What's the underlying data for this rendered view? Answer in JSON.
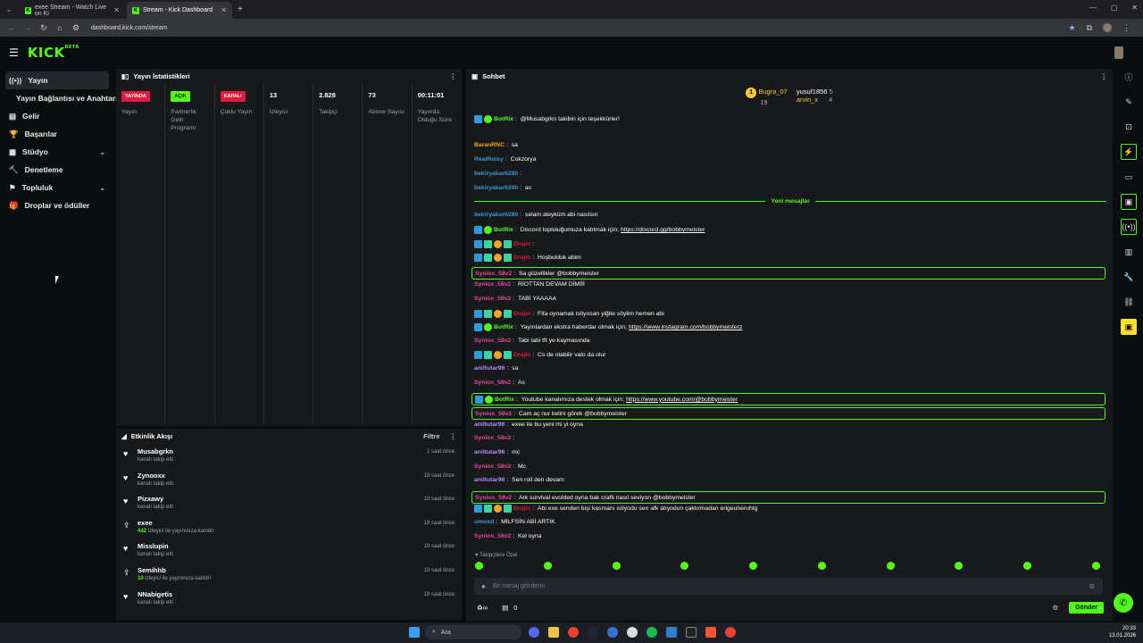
{
  "browser": {
    "tabs": [
      {
        "title": "exee Stream - Watch Live on Ki",
        "active": false
      },
      {
        "title": "Stream - Kick Dashboard",
        "active": true
      }
    ],
    "url": "dashboard.kick.com/stream"
  },
  "brand": {
    "logo": "KICK",
    "logo_sup": "BETA",
    "accent": "#53fc18"
  },
  "sidebar": {
    "items": [
      {
        "label": "Yayın",
        "icon": "broadcast-icon"
      },
      {
        "label": "Yayın Bağlantısı ve Anahtarı"
      },
      {
        "label": "Gelir",
        "icon": "wallet-icon"
      },
      {
        "label": "Başarılar",
        "icon": "trophy-icon"
      },
      {
        "label": "Stüdyo",
        "icon": "studio-icon"
      },
      {
        "label": "Denetleme",
        "icon": "hammer-icon"
      },
      {
        "label": "Topluluk",
        "icon": "community-icon"
      },
      {
        "label": "Droplar ve ödüller",
        "icon": "gift-icon"
      }
    ]
  },
  "stats": {
    "title": "Yayın İstatistikleri",
    "cols": [
      {
        "badge": "YAYINDA",
        "label": "Yayın"
      },
      {
        "badge": "AÇIK",
        "label": "Partnerlik Gelir Programı"
      },
      {
        "badge": "KAPALI",
        "label": "Çoklu Yayın"
      },
      {
        "value": "13",
        "label": "İzleyici"
      },
      {
        "value": "2.828",
        "label": "Takipçi"
      },
      {
        "value": "73",
        "label": "Abone Sayısı"
      },
      {
        "value": "00:11:01",
        "label": "Yayında Olduğu Süre"
      }
    ]
  },
  "activity": {
    "title": "Etkinlik Akışı",
    "filter": "Filtre",
    "rows": [
      {
        "name": "Musabgrkn",
        "sub": "kanalı takip etti",
        "time": "1 saat önce",
        "icon": "heart-icon"
      },
      {
        "name": "Zynooxx",
        "sub": "kanalı takip etti",
        "time": "19 saat önce",
        "icon": "heart-icon"
      },
      {
        "name": "Pizxawy",
        "sub": "kanalı takip etti",
        "time": "19 saat önce",
        "icon": "heart-icon"
      },
      {
        "name": "exee",
        "count": "442",
        "sub": "izleyici ile yayınınıza katıldı!",
        "time": "19 saat önce",
        "icon": "raid-icon"
      },
      {
        "name": "Misslupin",
        "sub": "kanalı takip etti",
        "time": "19 saat önce",
        "icon": "heart-icon"
      },
      {
        "name": "Semihhb",
        "count": "10",
        "sub": "izleyici ile yayınınıza katıldı!",
        "time": "19 saat önce",
        "icon": "raid-icon"
      },
      {
        "name": "NNabigetis",
        "sub": "kanalı takip etti",
        "time": "19 saat önce",
        "icon": "heart-icon"
      }
    ]
  },
  "chat": {
    "title": "Sohbet",
    "pinned": [
      {
        "name": "Bugra_07",
        "count": "19"
      },
      {
        "name": "yusuf1856",
        "count": "5"
      },
      {
        "name": "arvin_x",
        "count": "4"
      }
    ],
    "new_messages": "Yeni mesajlar",
    "messages": [
      {
        "user": "BotRix",
        "color": "#53fc18",
        "text": "@Musabgrkn takibin için teşekkürler!",
        "badges": [
          "b-blue",
          "b-green"
        ]
      },
      {
        "user": "BaranRNC",
        "color": "#f5a623",
        "text": "sa"
      },
      {
        "user": "RealRoisy",
        "color": "#2d9cdb",
        "text": "Cokzorya"
      },
      {
        "user": "bekiryakar6280",
        "color": "#2d9cdb",
        "text": ""
      },
      {
        "user": "bekiryakar6280",
        "color": "#2d9cdb",
        "text": "as"
      },
      {
        "user": "bekiryakar6280",
        "color": "#2d9cdb",
        "text": "selam aleyküm abi nasılsın"
      },
      {
        "user": "BotRix",
        "color": "#53fc18",
        "text": "Discord topluluğumuza katılmak için; ",
        "link": "https://discord.gg/bobbymeister",
        "badges": [
          "b-blue",
          "b-green"
        ]
      },
      {
        "user": "Drajin",
        "color": "#e21b3c",
        "text": "",
        "badges": [
          "b-blue",
          "b-teal",
          "b-gold",
          "b-teal"
        ]
      },
      {
        "user": "Drajin",
        "color": "#e21b3c",
        "text": "Hoşbulduk abim",
        "badges": [
          "b-blue",
          "b-teal",
          "b-gold",
          "b-teal"
        ]
      },
      {
        "user": "Syniox_58v2",
        "color": "#e04a9a",
        "text": "Sa güzellikler @bobbymeister",
        "hl": true
      },
      {
        "user": "Syniox_58v2",
        "color": "#e04a9a",
        "text": "RİOTTAN DEVAM DİMİİİ"
      },
      {
        "user": "Syniox_58v2",
        "color": "#e04a9a",
        "text": "TABİ YAAAAA"
      },
      {
        "user": "Drajin",
        "color": "#e21b3c",
        "text": "Fifa oynamak istiyosan yiğite söylim hemen abi",
        "badges": [
          "b-blue",
          "b-teal",
          "b-gold",
          "b-teal"
        ]
      },
      {
        "user": "BotRix",
        "color": "#53fc18",
        "text": "Yayınlardan ekstra haberdar olmak için; ",
        "link": "https://www.instagram.com/bobbymeisterz",
        "badges": [
          "b-blue",
          "b-green"
        ]
      },
      {
        "user": "Syniox_58v2",
        "color": "#e04a9a",
        "text": "Tabi tabi tft ye kaymasında"
      },
      {
        "user": "Drajin",
        "color": "#e21b3c",
        "text": "Cs de olabilir valo da olur",
        "badges": [
          "b-blue",
          "b-teal",
          "b-gold",
          "b-teal"
        ]
      },
      {
        "user": "aniltutar96",
        "color": "#b38cff",
        "text": "sa"
      },
      {
        "user": "Syniox_58v2",
        "color": "#e04a9a",
        "text": "As"
      },
      {
        "user": "BotRix",
        "color": "#53fc18",
        "text": "Youtube kanalımıza destek olmak için; ",
        "link": "https://www.youtube.com/@bobbymeister",
        "badges": [
          "b-blue",
          "b-green"
        ],
        "hl": true
      },
      {
        "user": "Syniox_58v2",
        "color": "#e04a9a",
        "text": "Cam aç nur kelini görek @bobbymeister",
        "hl": true
      },
      {
        "user": "aniltutar96",
        "color": "#b38cff",
        "text": "exee ile bu yeni mi yi oyna"
      },
      {
        "user": "Syniox_58v2",
        "color": "#e04a9a",
        "text": ""
      },
      {
        "user": "aniltutar96",
        "color": "#b38cff",
        "text": "mc"
      },
      {
        "user": "Syniox_58v2",
        "color": "#e04a9a",
        "text": "Mc"
      },
      {
        "user": "aniltutar96",
        "color": "#b38cff",
        "text": "Sen roll den devam"
      },
      {
        "user": "Syniox_58v2",
        "color": "#e04a9a",
        "text": "Ark survival evolded oyna bak crafti nasıl seviyon @bobbymeister",
        "hl": true
      },
      {
        "user": "Drajin",
        "color": "#e21b3c",
        "text": "Abi exe senden bişi kasmanı istiyodu sen afk atıyodun çaktırmadan erlgeuheruhtg",
        "badges": [
          "b-blue",
          "b-teal",
          "b-gold",
          "b-teal"
        ]
      },
      {
        "user": "umoxd",
        "color": "#2d9cdb",
        "text": "MİLFSİN ABİ ARTIK"
      },
      {
        "user": "Syniox_58v2",
        "color": "#e04a9a",
        "text": "Kel oyna"
      }
    ],
    "follow_only": "Takipçilere Özel",
    "input_placeholder": "Bir mesaj gönderin",
    "bottom_count": "0",
    "send_label": "Gönder"
  },
  "taskbar": {
    "search": "Ara",
    "time": "20:33",
    "date": "13.01.2026"
  }
}
